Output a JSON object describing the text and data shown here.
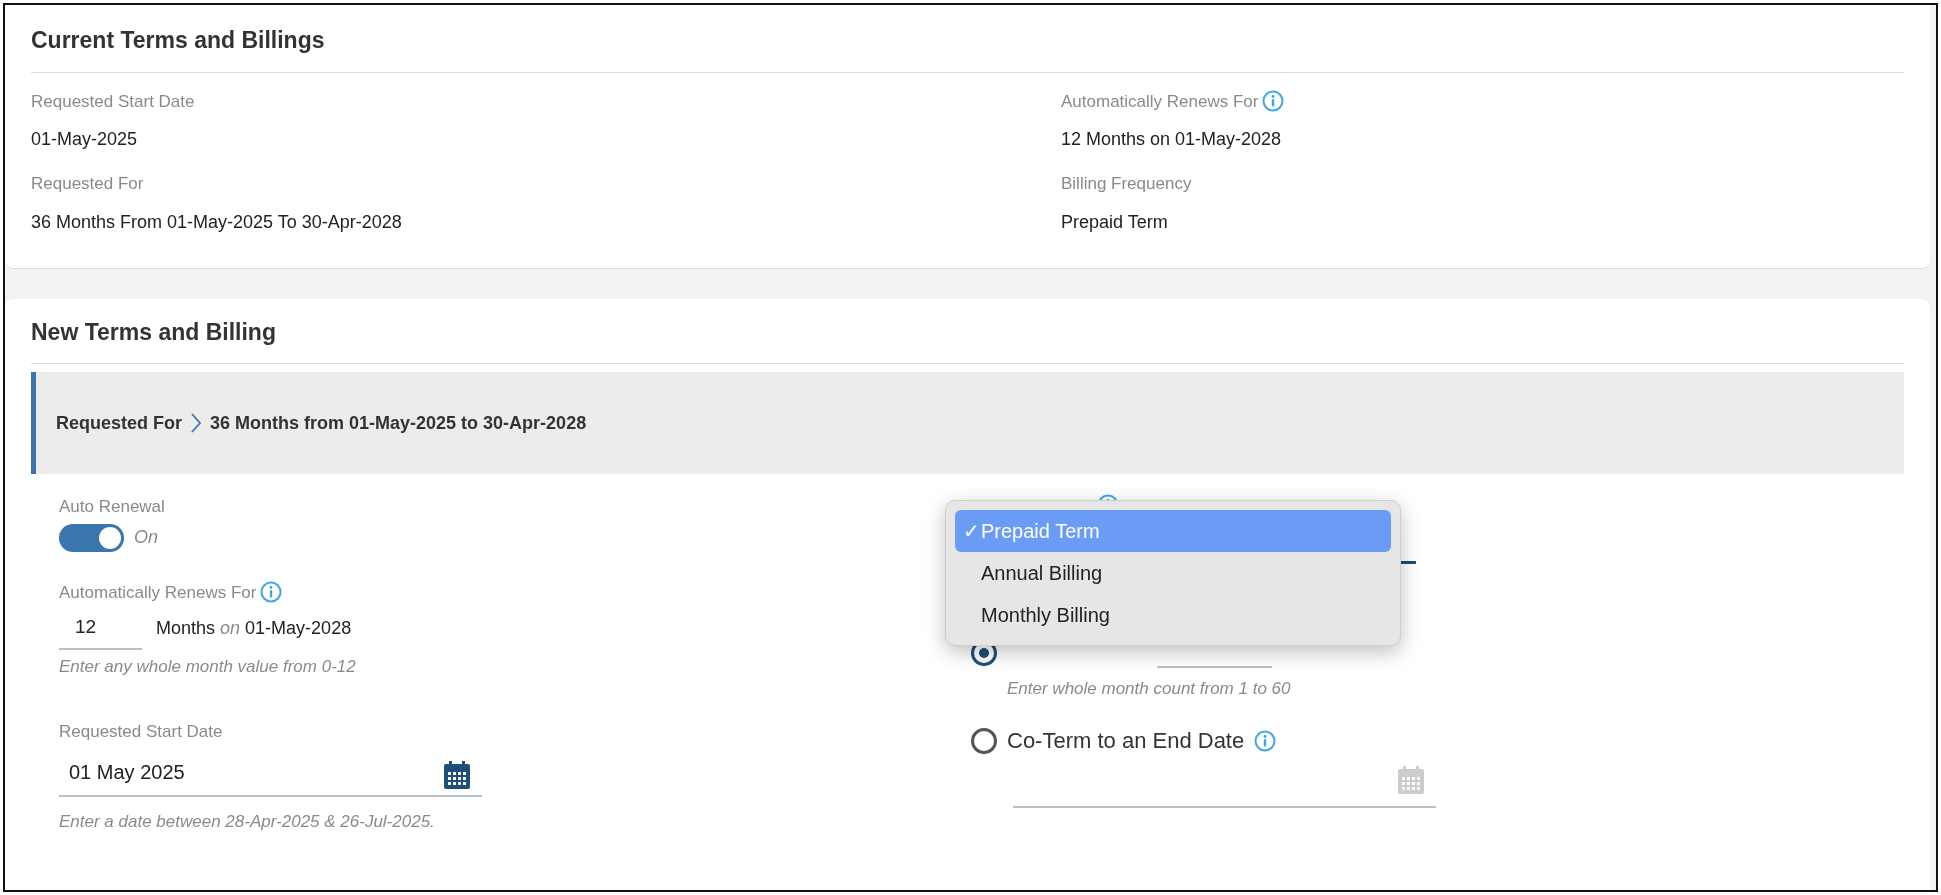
{
  "current": {
    "title": "Current Terms and Billings",
    "fields": [
      {
        "label": "Requested Start Date",
        "value": "01-May-2025",
        "info": false
      },
      {
        "label": "Automatically Renews For",
        "value": "12 Months on 01-May-2028",
        "info": true
      },
      {
        "label": "Requested For",
        "value": "36 Months From 01-May-2025 To 30-Apr-2028",
        "info": false
      },
      {
        "label": "Billing Frequency",
        "value": "Prepaid Term",
        "info": false
      }
    ]
  },
  "new": {
    "title": "New Terms and Billing",
    "banner": {
      "label": "Requested For",
      "value": "36 Months from 01-May-2025 to 30-Apr-2028"
    },
    "auto_renewal": {
      "label": "Auto Renewal",
      "on": true,
      "state_text": "On"
    },
    "renews_for": {
      "label": "Automatically Renews For",
      "value": "12",
      "unit": "Months",
      "on_word": "on",
      "date": "01-May-2028",
      "hint": "Enter any whole month value from 0-12"
    },
    "start_date": {
      "label": "Requested Start Date",
      "value": "01 May 2025",
      "hint": "Enter a date between 28-Apr-2025 & 26-Jul-2025."
    },
    "billing_frequency": {
      "check_mark": "✓",
      "options": [
        {
          "label": "Prepaid Term",
          "selected": true
        },
        {
          "label": "Annual Billing",
          "selected": false
        },
        {
          "label": "Monthly Billing",
          "selected": false
        }
      ]
    },
    "term_options": [
      {
        "kind": "months",
        "selected": true,
        "hint": "Enter whole month count from 1 to 60",
        "info": false
      },
      {
        "kind": "date",
        "label": "Co-Term to an End Date",
        "selected": false,
        "info": true
      }
    ]
  }
}
